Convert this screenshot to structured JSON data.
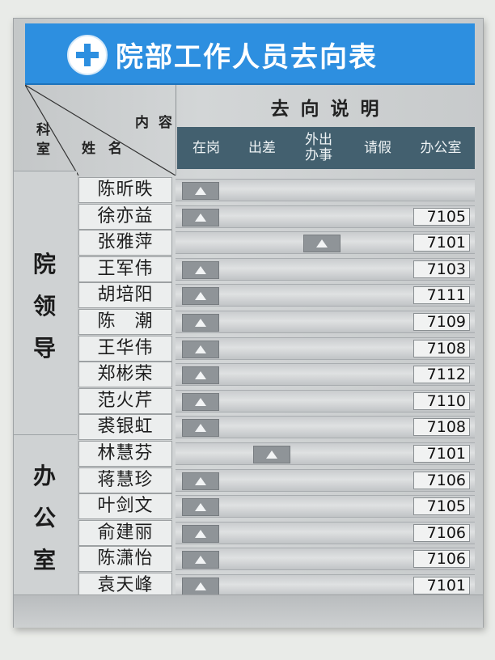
{
  "board": {
    "title": "院部工作人员去向表",
    "corner": {
      "content_label": "内 容",
      "name_label": "姓 名",
      "dept_label": "科室"
    },
    "direction_title": "去 向 说 明",
    "columns": [
      "在岗",
      "出差",
      "外出\n办事",
      "请假",
      "办公室"
    ],
    "groups": [
      {
        "label": "院\n领\n导"
      },
      {
        "label": "办\n公\n室"
      }
    ],
    "rows": [
      {
        "name": "陈昕昳",
        "status": "在岗",
        "room": ""
      },
      {
        "name": "徐亦益",
        "status": "在岗",
        "room": "7105"
      },
      {
        "name": "张雅萍",
        "status": "外出办事",
        "room": "7101"
      },
      {
        "name": "王军伟",
        "status": "在岗",
        "room": "7103"
      },
      {
        "name": "胡培阳",
        "status": "在岗",
        "room": "7111"
      },
      {
        "name": "陈　潮",
        "status": "在岗",
        "room": "7109"
      },
      {
        "name": "王华伟",
        "status": "在岗",
        "room": "7108"
      },
      {
        "name": "郑彬荣",
        "status": "在岗",
        "room": "7112"
      },
      {
        "name": "范火芹",
        "status": "在岗",
        "room": "7110"
      },
      {
        "name": "裘银虹",
        "status": "在岗",
        "room": "7108"
      },
      {
        "name": "林慧芬",
        "status": "出差",
        "room": "7101"
      },
      {
        "name": "蒋慧珍",
        "status": "在岗",
        "room": "7106"
      },
      {
        "name": "叶剑文",
        "status": "在岗",
        "room": "7105"
      },
      {
        "name": "俞建丽",
        "status": "在岗",
        "room": "7106"
      },
      {
        "name": "陈潇怡",
        "status": "在岗",
        "room": "7106"
      },
      {
        "name": "袁天峰",
        "status": "在岗",
        "room": "7101"
      }
    ]
  },
  "colors": {
    "title_bar": "#2d8fe0",
    "header_bar": "#43606f",
    "slider": "#8f9498"
  },
  "icons": {
    "logo": "hospital-cross-logo",
    "slider_marker": "triangle-up-icon"
  }
}
